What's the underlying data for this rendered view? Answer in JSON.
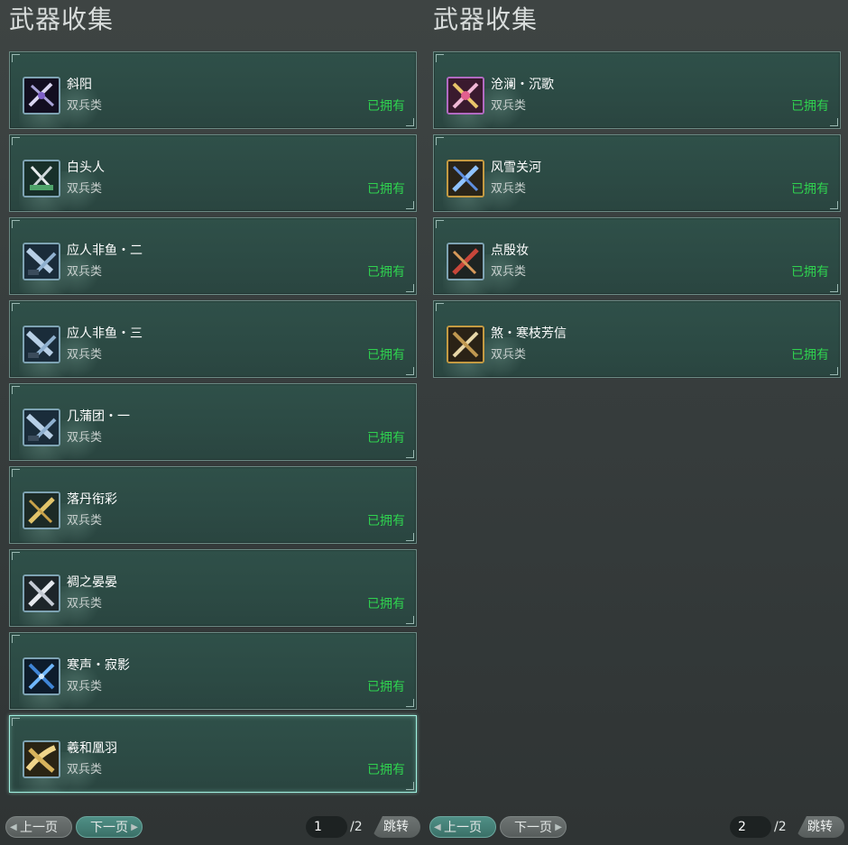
{
  "left_panel": {
    "title": "武器收集",
    "items": [
      {
        "name": "斜阳",
        "type": "双兵类",
        "status": "已拥有",
        "frame": "blue",
        "icon": "purple-silver-twin-blades-icon"
      },
      {
        "name": "白头人",
        "type": "双兵类",
        "status": "已拥有",
        "frame": "blue",
        "icon": "green-silver-twin-blades-icon"
      },
      {
        "name": "应人非鱼・二",
        "type": "双兵类",
        "status": "已拥有",
        "frame": "blue",
        "icon": "steel-blue-twin-blades-icon"
      },
      {
        "name": "应人非鱼・三",
        "type": "双兵类",
        "status": "已拥有",
        "frame": "blue",
        "icon": "steel-blue-twin-blades-icon"
      },
      {
        "name": "几蒲团・一",
        "type": "双兵类",
        "status": "已拥有",
        "frame": "blue",
        "icon": "steel-blue-twin-blades-icon"
      },
      {
        "name": "落丹衔彩",
        "type": "双兵类",
        "status": "已拥有",
        "frame": "blue",
        "icon": "golden-twin-blades-icon"
      },
      {
        "name": "裯之晏晏",
        "type": "双兵类",
        "status": "已拥有",
        "frame": "blue",
        "icon": "silver-twin-blades-icon"
      },
      {
        "name": "寒声・寂影",
        "type": "双兵类",
        "status": "已拥有",
        "frame": "blue",
        "icon": "ice-blue-twin-blades-icon"
      },
      {
        "name": "羲和凰羽",
        "type": "双兵类",
        "status": "已拥有",
        "frame": "blue",
        "icon": "golden-feather-blades-icon"
      }
    ],
    "pager": {
      "prev_label": "上一页",
      "next_label": "下一页",
      "current_page": "1",
      "total_pages": "/2",
      "jump_label": "跳转"
    }
  },
  "right_panel": {
    "title": "武器收集",
    "items": [
      {
        "name": "沧澜・沉歌",
        "type": "双兵类",
        "status": "已拥有",
        "frame": "purple",
        "icon": "pink-gold-twin-blades-icon"
      },
      {
        "name": "风雪关河",
        "type": "双兵类",
        "status": "已拥有",
        "frame": "gold",
        "icon": "blue-crystal-twin-blades-icon"
      },
      {
        "name": "点殷妆",
        "type": "双兵类",
        "status": "已拥有",
        "frame": "blue",
        "icon": "crimson-twin-blades-icon"
      },
      {
        "name": "煞・寒枝芳信",
        "type": "双兵类",
        "status": "已拥有",
        "frame": "gold",
        "icon": "bronze-twin-blades-icon"
      }
    ],
    "pager": {
      "prev_label": "上一页",
      "next_label": "下一页",
      "current_page": "2",
      "total_pages": "/2",
      "jump_label": "跳转"
    }
  },
  "colors": {
    "owned_status": "#2fd24f",
    "card_bg": "#2c4a44",
    "selected_border": "#9ff0df"
  }
}
